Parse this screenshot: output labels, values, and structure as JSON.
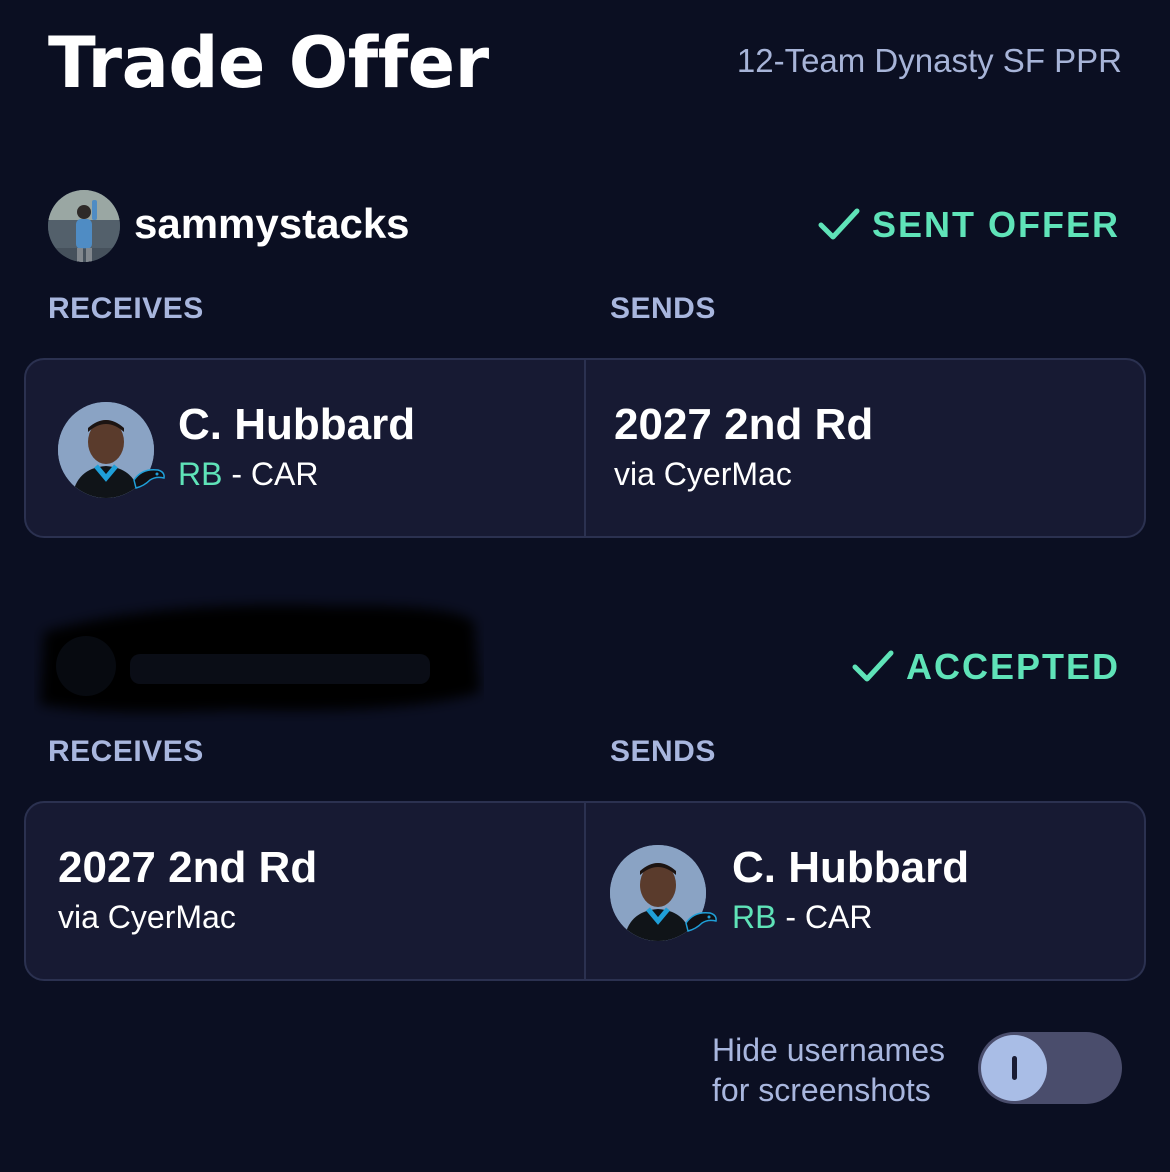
{
  "header": {
    "title": "Trade Offer",
    "league": "12-Team Dynasty SF PPR"
  },
  "offer1": {
    "username": "sammystacks",
    "status": "SENT OFFER",
    "receives_label": "RECEIVES",
    "sends_label": "SENDS",
    "receives_player": {
      "name": "C. Hubbard",
      "position": "RB",
      "team": " - CAR"
    },
    "sends_pick": {
      "name": "2027 2nd Rd",
      "via": "via CyerMac"
    }
  },
  "offer2": {
    "status": "ACCEPTED",
    "receives_label": "RECEIVES",
    "sends_label": "SENDS",
    "receives_pick": {
      "name": "2027 2nd Rd",
      "via": "via CyerMac"
    },
    "sends_player": {
      "name": "C. Hubbard",
      "position": "RB",
      "team": " - CAR"
    }
  },
  "settings": {
    "hide_line1": "Hide usernames",
    "hide_line2": "for screenshots",
    "toggle_on": false
  },
  "colors": {
    "background": "#0b0f22",
    "card": "#171a33",
    "accent": "#5fe3b8",
    "muted": "#a8b6de"
  }
}
